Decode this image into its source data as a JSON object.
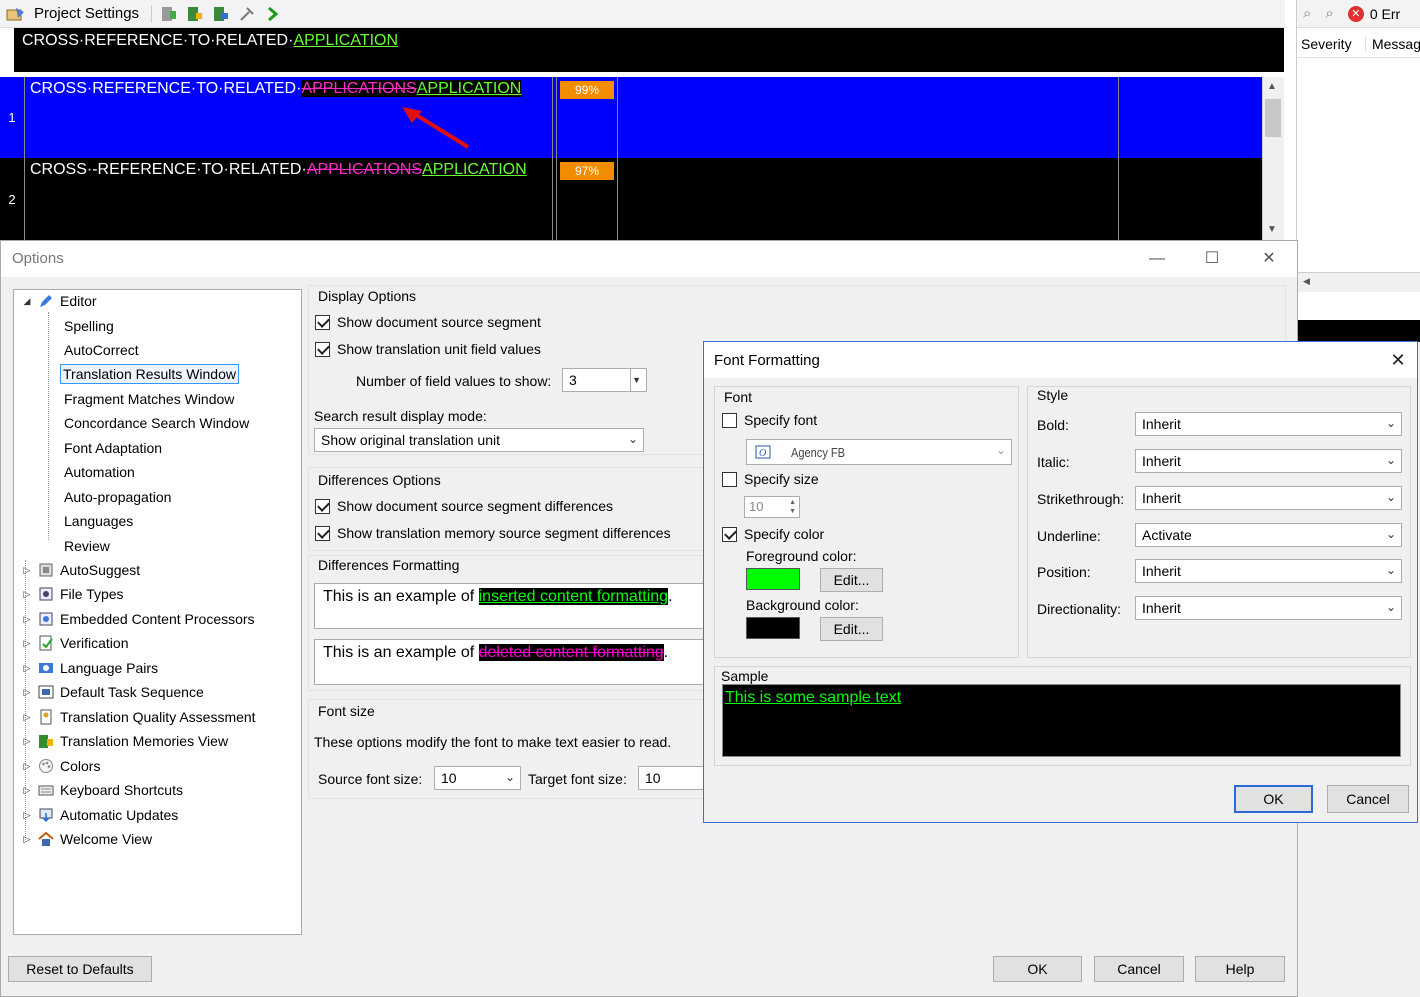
{
  "app": {
    "toolbar_title": "Project Settings",
    "source_bar": {
      "plain": "CROSS·REFERENCE·TO·RELATED·",
      "inserted": "APPLICATION"
    },
    "rows": [
      {
        "num": "1",
        "plain": "CROSS·REFERENCE·TO·RELATED·",
        "deleted": "APPLICATIONS",
        "inserted": "APPLICATION",
        "match": "99%",
        "bg": "#0000ff"
      },
      {
        "num": "2",
        "plain": "CROSS·-REFERENCE·TO·RELATED·",
        "deleted": "APPLICATIONS",
        "inserted": "APPLICATION",
        "match": "97%",
        "bg": "#000000"
      }
    ],
    "right_panel": {
      "error_count": "0 Err",
      "columns": [
        "Severity",
        "Messag"
      ]
    }
  },
  "options": {
    "title": "Options",
    "tree": [
      {
        "label": "Editor",
        "level": 0,
        "expanded": true,
        "icon": "pencil-icon"
      },
      {
        "label": "Spelling",
        "level": 1
      },
      {
        "label": "AutoCorrect",
        "level": 1
      },
      {
        "label": "Translation Results Window",
        "level": 1,
        "selected": true
      },
      {
        "label": "Fragment Matches Window",
        "level": 1
      },
      {
        "label": "Concordance Search Window",
        "level": 1
      },
      {
        "label": "Font Adaptation",
        "level": 1
      },
      {
        "label": "Automation",
        "level": 1
      },
      {
        "label": "Auto-propagation",
        "level": 1
      },
      {
        "label": "Languages",
        "level": 1
      },
      {
        "label": "Review",
        "level": 1
      },
      {
        "label": "AutoSuggest",
        "level": 0,
        "icon": "autosuggest-icon"
      },
      {
        "label": "File Types",
        "level": 0,
        "icon": "file-types-icon"
      },
      {
        "label": "Embedded Content Processors",
        "level": 0,
        "icon": "embedded-content-icon"
      },
      {
        "label": "Verification",
        "level": 0,
        "icon": "verification-icon"
      },
      {
        "label": "Language Pairs",
        "level": 0,
        "icon": "language-pairs-icon"
      },
      {
        "label": "Default Task Sequence",
        "level": 0,
        "icon": "task-sequence-icon"
      },
      {
        "label": "Translation Quality Assessment",
        "level": 0,
        "icon": "quality-assessment-icon"
      },
      {
        "label": "Translation Memories View",
        "level": 0,
        "icon": "translation-memories-icon"
      },
      {
        "label": "Colors",
        "level": 0,
        "icon": "colors-icon"
      },
      {
        "label": "Keyboard Shortcuts",
        "level": 0,
        "icon": "keyboard-icon"
      },
      {
        "label": "Automatic Updates",
        "level": 0,
        "icon": "updates-icon"
      },
      {
        "label": "Welcome View",
        "level": 0,
        "icon": "home-icon"
      }
    ],
    "display_options": {
      "title": "Display Options",
      "show_source": "Show document source segment",
      "show_field_values": "Show translation unit field values",
      "num_field_label": "Number of field values to show:",
      "num_field_value": "3",
      "search_mode_label": "Search result display mode:",
      "search_mode_value": "Show original translation unit"
    },
    "differences_options": {
      "title": "Differences Options",
      "show_source_diff": "Show document source segment differences",
      "show_tm_diff": "Show translation memory source segment differences"
    },
    "differences_formatting": {
      "title": "Differences Formatting",
      "example_prefix": "This is an example of ",
      "inserted_example": "inserted content formatting",
      "deleted_example": "deleted content formatting"
    },
    "font_size": {
      "title": "Font size",
      "description": "These options modify the font to make text easier to read.",
      "source_label": "Source font size:",
      "source_value": "10",
      "target_label": "Target font size:",
      "target_value": "10"
    },
    "buttons": {
      "reset": "Reset to Defaults",
      "ok": "OK",
      "cancel": "Cancel",
      "help": "Help"
    }
  },
  "font_formatting": {
    "title": "Font Formatting",
    "font_group": "Font",
    "specify_font": "Specify font",
    "font_value": "Agency FB",
    "specify_size": "Specify size",
    "size_value": "10",
    "specify_color": "Specify color",
    "fg_label": "Foreground color:",
    "bg_label": "Background color:",
    "edit_label": "Edit...",
    "fg_color": "#00ff00",
    "bg_color": "#000000",
    "style_group": "Style",
    "style_rows": [
      {
        "label": "Bold:",
        "value": "Inherit"
      },
      {
        "label": "Italic:",
        "value": "Inherit"
      },
      {
        "label": "Strikethrough:",
        "value": "Inherit"
      },
      {
        "label": "Underline:",
        "value": "Activate"
      },
      {
        "label": "Position:",
        "value": "Inherit"
      },
      {
        "label": "Directionality:",
        "value": "Inherit"
      }
    ],
    "sample_label": "Sample",
    "sample_text": "This is some sample text",
    "ok": "OK",
    "cancel": "Cancel"
  }
}
